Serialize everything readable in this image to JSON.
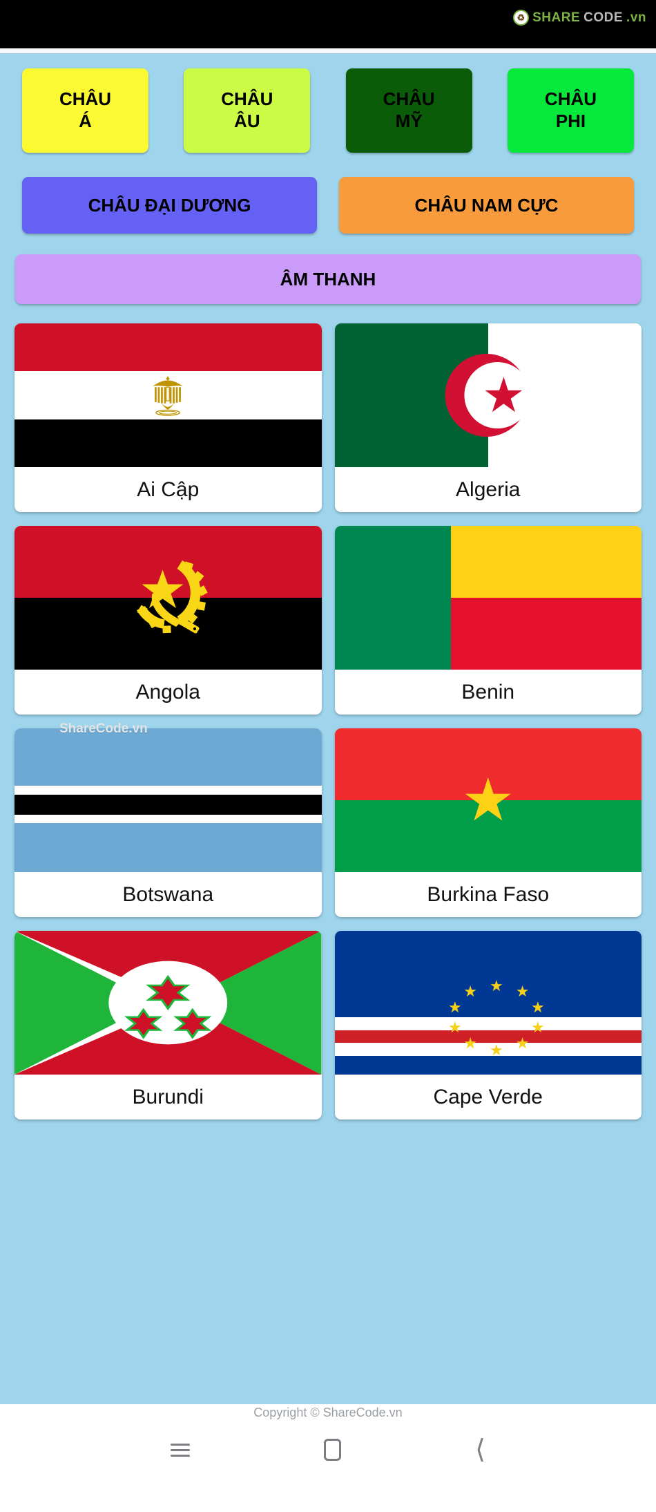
{
  "statusbar": {
    "logo": {
      "mark": "icon",
      "share": "SHARE",
      "code": "CODE",
      "vn": ".vn"
    }
  },
  "theme": {
    "page_bg": "#9fd5ec",
    "card_bg": "#ffffff",
    "status_bg": "#000000"
  },
  "continent_buttons": [
    {
      "line1": "CHÂU",
      "line2": "Á",
      "color": "#fbf932",
      "text_color": "#000000"
    },
    {
      "line1": "CHÂU",
      "line2": "ÂU",
      "color": "#ccfb45",
      "text_color": "#000000"
    },
    {
      "line1": "CHÂU",
      "line2": "MỸ",
      "color": "#0a5c08",
      "text_color": "#000000"
    },
    {
      "line1": "CHÂU",
      "line2": "PHI",
      "color": "#07e83c",
      "text_color": "#000000"
    }
  ],
  "wide_buttons": [
    {
      "label": "CHÂU ĐẠI DƯƠNG",
      "color": "#6561f5"
    },
    {
      "label": "CHÂU NAM CỰC",
      "color": "#f79b3c"
    }
  ],
  "sound_button": {
    "label": "ÂM THANH",
    "color": "#ca9bf9"
  },
  "flags": [
    {
      "name": "Ai Cập",
      "code": "eg"
    },
    {
      "name": "Algeria",
      "code": "dz"
    },
    {
      "name": "Angola",
      "code": "ao"
    },
    {
      "name": "Benin",
      "code": "bj"
    },
    {
      "name": "Botswana",
      "code": "bw"
    },
    {
      "name": "Burkina Faso",
      "code": "bf"
    },
    {
      "name": "Burundi",
      "code": "bi"
    },
    {
      "name": "Cape Verde",
      "code": "cv"
    }
  ],
  "watermarks": {
    "angola": "ShareCode.vn"
  },
  "footer": {
    "copyright": "Copyright © ShareCode.vn",
    "nav": {
      "recents": "menu-icon",
      "home": "home-icon",
      "back": "back-icon"
    }
  }
}
